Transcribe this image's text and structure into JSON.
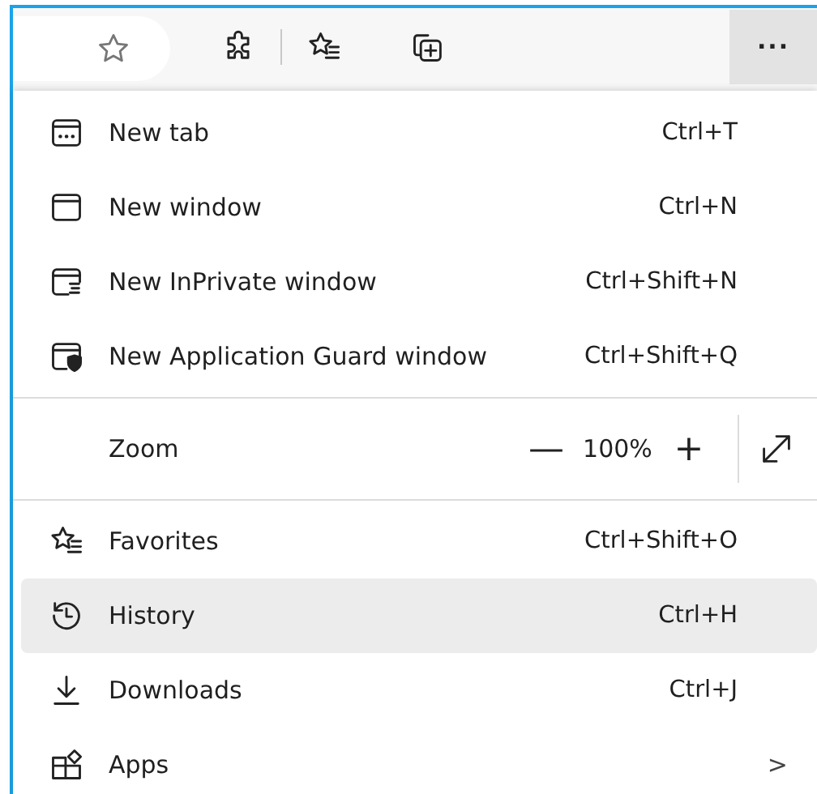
{
  "toolbar": {
    "more_button": "..."
  },
  "menu": [
    {
      "kind": "item",
      "label": "New tab",
      "shortcut": "Ctrl+T",
      "selected": false
    },
    {
      "kind": "item",
      "label": "New window",
      "shortcut": "Ctrl+N",
      "selected": false
    },
    {
      "kind": "item",
      "label": "New InPrivate window",
      "shortcut": "Ctrl+Shift+N",
      "selected": false
    },
    {
      "kind": "item",
      "label": "New Application Guard window",
      "shortcut": "Ctrl+Shift+Q",
      "selected": false
    },
    {
      "kind": "divider"
    },
    {
      "kind": "zoom",
      "label": "Zoom",
      "minus": "—",
      "value": "100%",
      "plus": "+"
    },
    {
      "kind": "divider"
    },
    {
      "kind": "item",
      "label": "Favorites",
      "shortcut": "Ctrl+Shift+O",
      "selected": false
    },
    {
      "kind": "item",
      "label": "History",
      "shortcut": "Ctrl+H",
      "selected": true
    },
    {
      "kind": "item",
      "label": "Downloads",
      "shortcut": "Ctrl+J",
      "selected": false
    },
    {
      "kind": "submenu",
      "label": "Apps",
      "arrow": ">",
      "selected": false
    }
  ]
}
